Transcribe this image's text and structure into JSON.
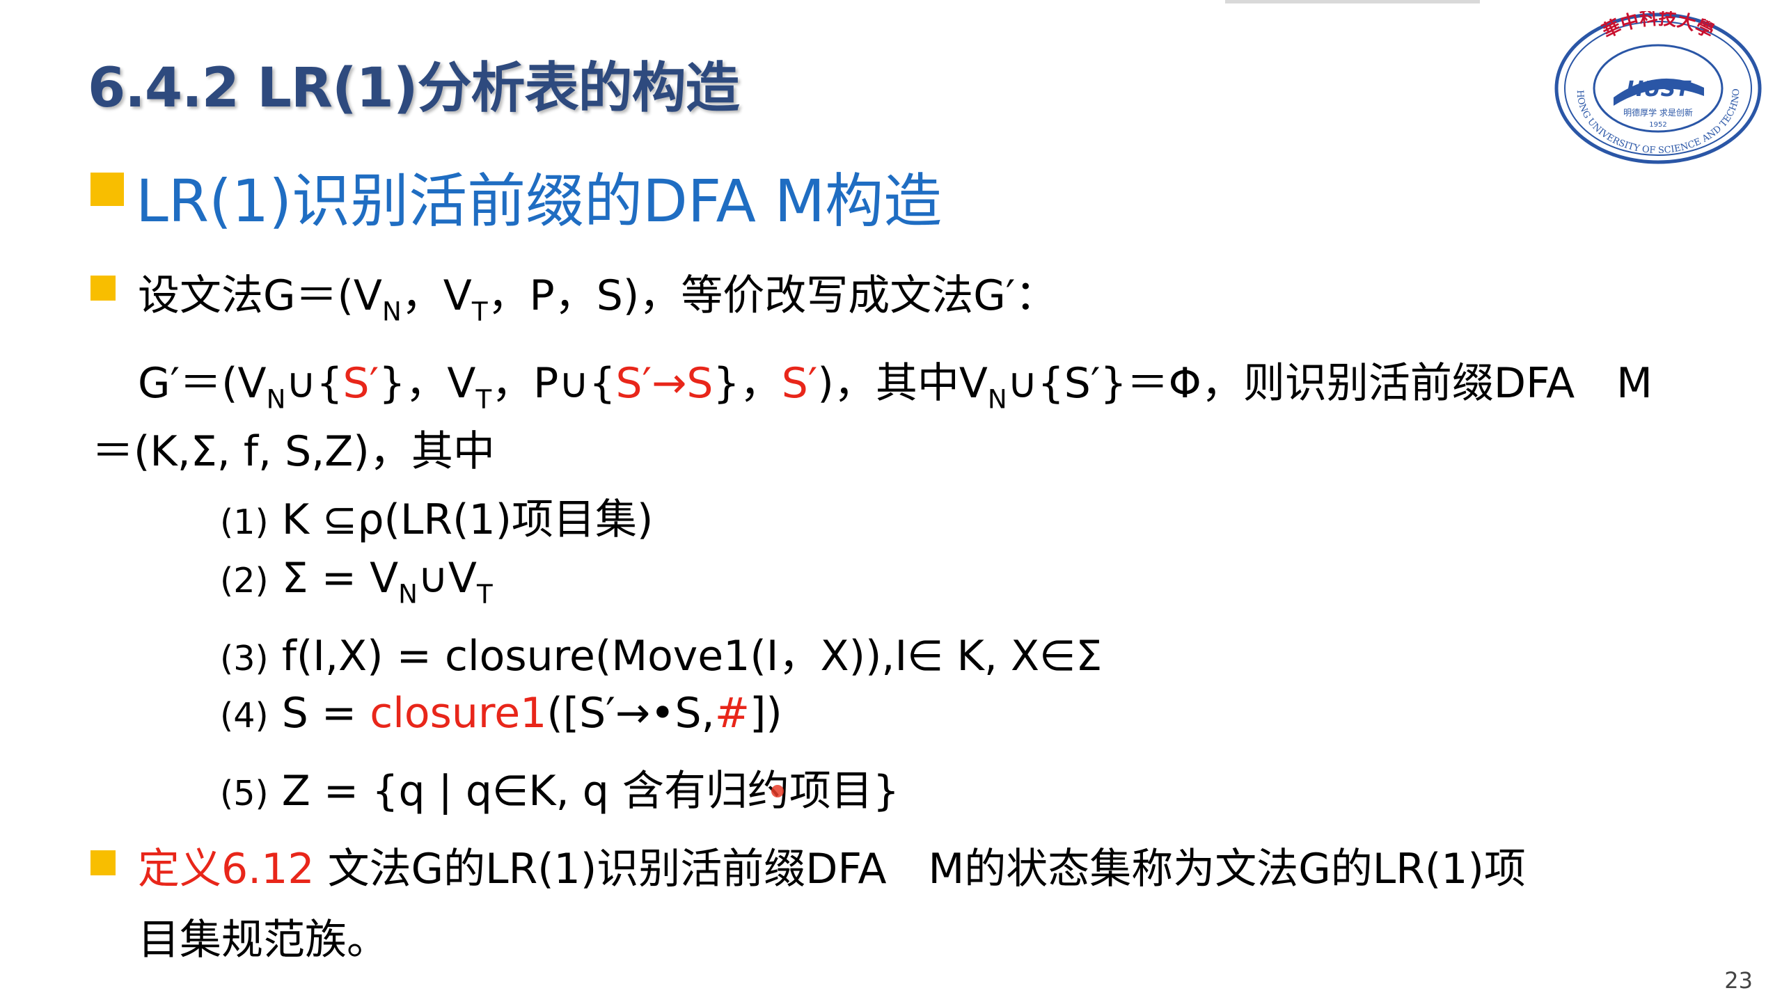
{
  "slide": {
    "title": "6.4.2 LR(1)分析表的构造",
    "heading": "LR(1)识别活前缀的DFA M构造",
    "page_number": "23"
  },
  "logo": {
    "top_text": "華中科技大學",
    "ring_text": "HUAZHONG UNIVERSITY OF SCIENCE AND TECHNOLOGY",
    "center_text": "HUST",
    "motto": "明德厚学 求是创新",
    "year": "1952"
  },
  "line1": {
    "a": "设文法G＝(V",
    "sub1": "N",
    "b": "，V",
    "sub2": "T",
    "c": "，P，S)，等价改写成文法G′："
  },
  "line2": {
    "a": "G′＝(V",
    "sub1": "N",
    "b": "∪{",
    "red1": "S′",
    "c": "}，V",
    "sub2": "T",
    "d": "，P∪{",
    "red2": "S′→S",
    "e": "}，",
    "red3": "S′",
    "f": ")，其中V",
    "sub3": "N",
    "g": "∪{S′}＝Φ，则识别活前缀DFA　M"
  },
  "line3": {
    "text": "＝(K,Σ, f, S,Z)，其中"
  },
  "item1": {
    "num": "(1)",
    "text": " K ⊆ρ(LR(1)项目集)"
  },
  "item2": {
    "num": "(2)",
    "a": " Σ  =  V",
    "sub1": "N",
    "b": "∪V",
    "sub2": "T"
  },
  "item3": {
    "num": "(3)",
    "text": " f(I,X)  =  closure(Move1(I，X)),I∈ K, X∈Σ"
  },
  "item4": {
    "num": "(4)",
    "a": " S  =  ",
    "red1": "closure1",
    "b": "([S′→•S,",
    "red2": "#",
    "c": "])"
  },
  "item5": {
    "num": "(5)",
    "text": " Z   =  {q | q∈K, q 含有归约项目}"
  },
  "definition": {
    "label": "定义6.12",
    "text1": "  文法G的LR(1)识别活前缀DFA　M的状态集称为文法G的LR(1)项",
    "text2": "目集规范族。"
  },
  "colors": {
    "title": "#2e4a7e",
    "heading": "#1f6dc2",
    "bullet": "#f8be00",
    "red": "#e8261a",
    "logo_blue": "#2a56a6",
    "logo_red": "#c8102e"
  },
  "icons": [
    "bullet-square-icon",
    "university-logo-icon"
  ]
}
